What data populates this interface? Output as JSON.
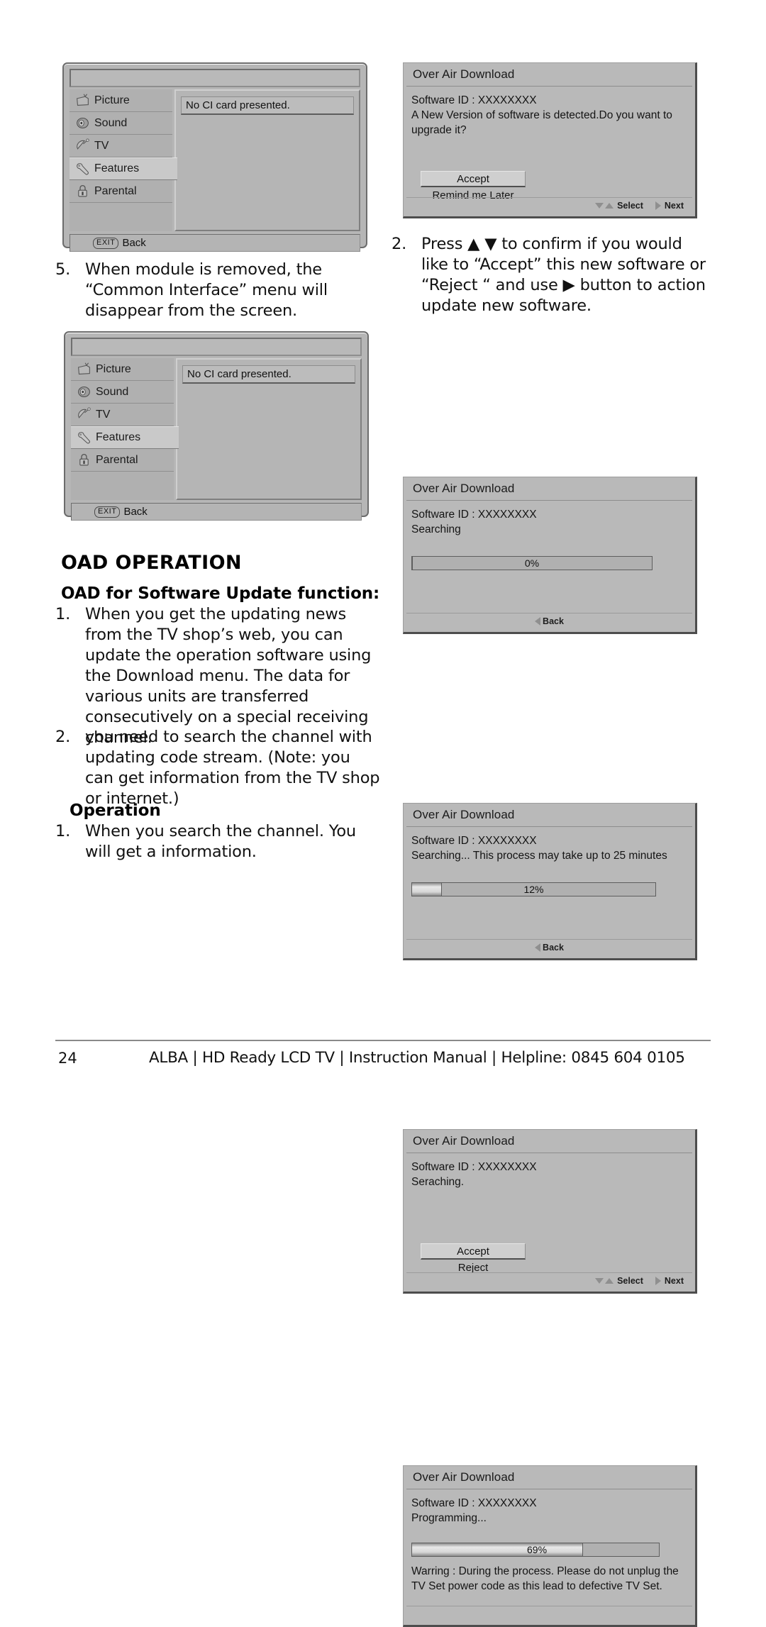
{
  "page": {
    "number": "24",
    "footer_text": "ALBA | HD Ready LCD TV | Instruction Manual | Helpline: 0845 604 0105"
  },
  "osd_menu": {
    "items": [
      {
        "label": "Picture",
        "icon": "television-icon",
        "selected": false
      },
      {
        "label": "Sound",
        "icon": "speaker-icon",
        "selected": false
      },
      {
        "label": "TV",
        "icon": "satellite-dish-icon",
        "selected": false
      },
      {
        "label": "Features",
        "icon": "wrench-icon",
        "selected": true
      },
      {
        "label": "Parental",
        "icon": "padlock-icon",
        "selected": false
      }
    ],
    "message": "No CI card presented.",
    "footer_key": "EXIT",
    "footer_label": "Back"
  },
  "left_column": {
    "step5": {
      "num": "5.",
      "text": "When module is removed, the “Common Interface” menu will disappear from the screen."
    },
    "heading": "OAD OPERATION",
    "subheading": "OAD for Software Update function:",
    "step1": {
      "num": "1.",
      "text": "When you get the updating news from the TV shop’s web, you can update the operation software using the Download menu. The data for various units are transferred consecutively on a special receiving channel."
    },
    "step2": {
      "num": "2.",
      "text": "you need to search the channel with updating code stream. (Note: you can get information from the TV shop or internet.)"
    },
    "operation_heading": "Operation",
    "op_step1": {
      "num": "1.",
      "text": "When you search the channel. You will get a information."
    }
  },
  "right_column": {
    "step2": {
      "num": "2.",
      "text": "Press ▲ ▼ to confirm if you would like to “Accept” this new software or “Reject “ and use ▶ button to action update new software."
    }
  },
  "dialogs": [
    {
      "title": "Over Air Download",
      "software_id": "Software ID : XXXXXXXX",
      "status": "A New Version of software is detected.Do you want to upgrade it?",
      "primary_button": "Accept",
      "secondary_button": "Remind me Later",
      "footer_select": "Select",
      "footer_next": "Next"
    },
    {
      "title": "Over Air Download",
      "software_id": "Software ID : XXXXXXXX",
      "status": "Searching",
      "progress_label": "0%",
      "progress_value": 0,
      "footer_back": "Back"
    },
    {
      "title": "Over Air Download",
      "software_id": "Software ID : XXXXXXXX",
      "status": "Searching... This process may take up to 25 minutes",
      "progress_label": "12%",
      "progress_value": 12,
      "footer_back": "Back"
    },
    {
      "title": "Over Air Download",
      "software_id": "Software ID : XXXXXXXX",
      "status": "Seraching.",
      "primary_button": "Accept",
      "secondary_button": "Reject",
      "footer_select": "Select",
      "footer_next": "Next"
    },
    {
      "title": "Over Air Download",
      "software_id": "Software ID : XXXXXXXX",
      "status": "Programming...",
      "progress_label": "69%",
      "progress_value": 69,
      "warning": "Warring : During the process. Please do not unplug the TV Set power code as this lead to defective TV Set."
    }
  ]
}
